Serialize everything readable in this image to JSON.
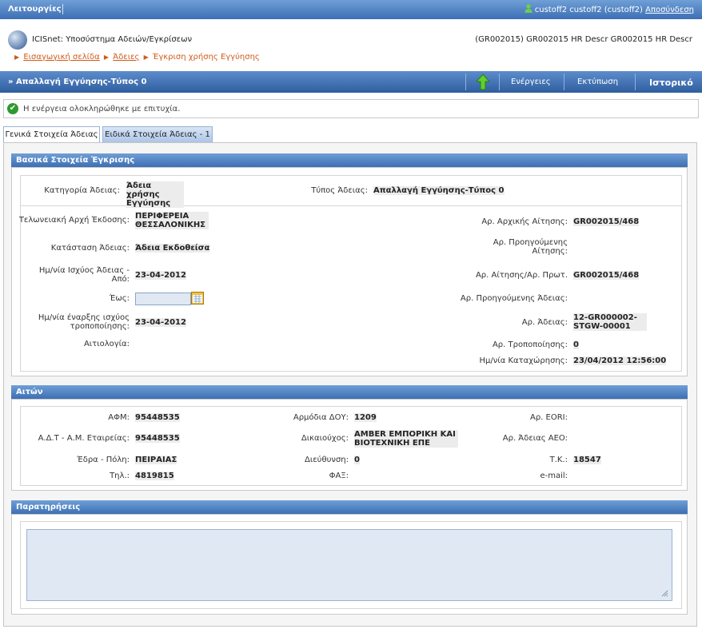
{
  "topbar": {
    "menu_label": "Λειτουργίες",
    "user_text": "custoff2 custoff2 (custoff2)",
    "logout_label": "Αποσύνδεση"
  },
  "header": {
    "app_name": "ICISnet: Υποσύστημα Αδειών/Εγκρίσεων",
    "user_info": "(GR002015) GR002015 HR Descr GR002015 HR Descr",
    "breadcrumb": [
      "Εισαγωγική σελίδα",
      "Άδειες",
      "Έγκριση χρήσης Εγγύησης"
    ]
  },
  "titlebar": {
    "title": "» Απαλλαγή Εγγύησης-Τύπος 0",
    "actions_label": "Ενέργειες",
    "print_label": "Εκτύπωση",
    "history_label": "Ιστορικό"
  },
  "success_message": "Η ενέργεια ολοκληρώθηκε με επιτυχία.",
  "tabs": [
    "Γενικά Στοιχεία Άδειας",
    "Ειδικά Στοιχεία Άδειας - 1"
  ],
  "basic": {
    "heading": "Βασικά Στοιχεία Έγκρισης",
    "category_label": "Κατηγορία Άδειας:",
    "category_value": "Άδεια χρήσης Εγγύησης",
    "type_label": "Τύπος Άδειας:",
    "type_value": "Απαλλαγή Εγγύησης-Τύπος 0",
    "customs_label": "Τελωνειακή Αρχή Έκδοσης:",
    "customs_value": "ΠΕΡΙΦΕΡΕΙΑ ΘΕΣΣΑΛΟΝΙΚΗΣ",
    "status_label": "Κατάσταση Άδειας:",
    "status_value": "Άδεια Εκδοθείσα",
    "valid_from_label": "Ημ/νία Ισχύος Άδειας - Από:",
    "valid_from_value": "23-04-2012",
    "valid_to_label": "Έως:",
    "amend_start_label": "Ημ/νία έναρξης ισχύος τροποποίησης:",
    "amend_start_value": "23-04-2012",
    "justification_label": "Αιτιολογία:",
    "initial_app_label": "Αρ. Αρχικής Αίτησης:",
    "initial_app_value": "GR002015/468",
    "prev_app_label": "Αρ. Προηγούμενης Αίτησης:",
    "app_proto_label": "Αρ. Αίτησης/Αρ. Πρωτ.",
    "app_proto_value": "GR002015/468",
    "prev_license_label": "Αρ. Προηγούμενης Άδειας:",
    "license_no_label": "Αρ. Άδειας:",
    "license_no_value": "12-GR000002-STGW-00001",
    "amend_no_label": "Αρ. Τροποποίησης:",
    "amend_no_value": "0",
    "registered_label": "Ημ/νία Καταχώρησης:",
    "registered_value": "23/04/2012 12:56:00"
  },
  "applicant": {
    "heading": "Αιτών",
    "afm_label": "ΑΦΜ:",
    "afm_value": "95448535",
    "doy_label": "Αρμόδια ΔΟΥ:",
    "doy_value": "1209",
    "eori_label": "Αρ. EORI:",
    "adt_label": "Α.Δ.Τ - Α.Μ. Εταιρείας:",
    "adt_value": "95448535",
    "owner_label": "Δικαιούχος:",
    "owner_value": "AMBER ΕΜΠΟΡΙΚΗ ΚΑΙ ΒΙΟΤΕΧΝΙΚΗ ΕΠΕ",
    "aeo_label": "Αρ. Άδειας AEO:",
    "city_label": "Έδρα - Πόλη:",
    "city_value": "ΠΕΙΡΑΙΑΣ",
    "address_label": "Διεύθυνση:",
    "address_value": "0",
    "zip_label": "Τ.Κ.:",
    "zip_value": "18547",
    "phone_label": "Τηλ.:",
    "phone_value": "4819815",
    "fax_label": "ΦΑΞ:",
    "email_label": "e-mail:"
  },
  "notes": {
    "heading": "Παρατηρήσεις"
  },
  "colors": {
    "accent": "#3d6fb4",
    "link": "#d05a1a",
    "success": "#2e9a2e"
  }
}
